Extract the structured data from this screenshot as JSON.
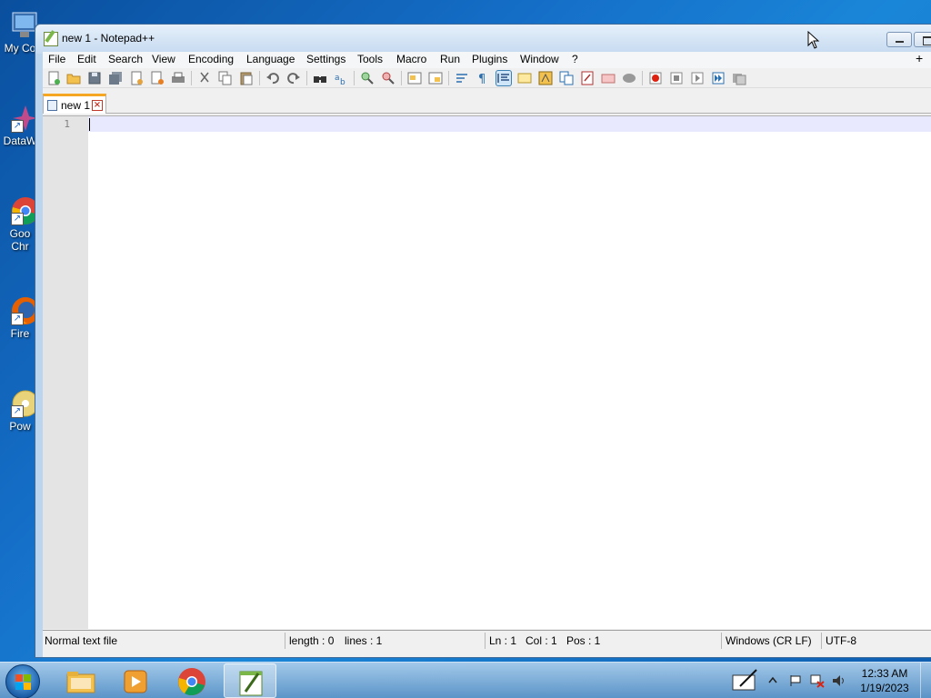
{
  "desktop": {
    "icons": [
      {
        "label": "My Co",
        "icon": "computer-icon"
      },
      {
        "label": "DataW",
        "icon": "datawrangler-icon"
      },
      {
        "label": "Goo",
        "label2": "Chr",
        "icon": "chrome-icon"
      },
      {
        "label": "Fire",
        "icon": "firefox-icon"
      },
      {
        "label": "Pow",
        "icon": "powerdvd-icon"
      }
    ]
  },
  "window": {
    "title": "new 1 - Notepad++",
    "menu": [
      "File",
      "Edit",
      "Search",
      "View",
      "Encoding",
      "Language",
      "Settings",
      "Tools",
      "Macro",
      "Run",
      "Plugins",
      "Window",
      "?"
    ],
    "menu_plus": "+",
    "tab": {
      "label": "new 1"
    },
    "editor": {
      "line_numbers": [
        "1"
      ],
      "content": ""
    },
    "status": {
      "file_type": "Normal text file",
      "length": "length : 0",
      "lines": "lines : 1",
      "ln": "Ln : 1",
      "col": "Col : 1",
      "pos": "Pos : 1",
      "eol": "Windows (CR LF)",
      "encoding": "UTF-8"
    }
  },
  "taskbar": {
    "apps": [
      "file-explorer",
      "media-player",
      "google-chrome",
      "notepad-plus-plus"
    ],
    "active_app": "notepad-plus-plus",
    "clock": {
      "time": "12:33 AM",
      "date": "1/19/2023"
    }
  },
  "colors": {
    "accent_tab": "#f5a623",
    "current_line": "#e8e8ff",
    "desktop": "#1570c9"
  }
}
